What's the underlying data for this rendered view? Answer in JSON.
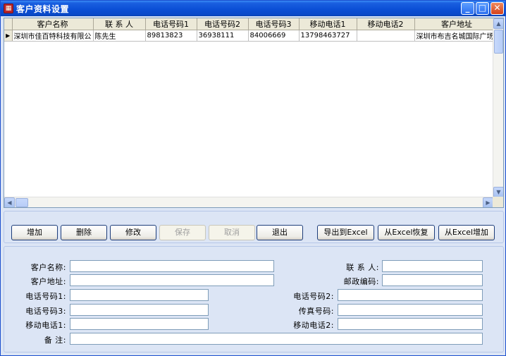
{
  "window": {
    "title": "客户资料设置"
  },
  "grid": {
    "columns": [
      "客户名称",
      "联 系 人",
      "电话号码1",
      "电话号码2",
      "电话号码3",
      "移动电话1",
      "移动电话2",
      "客户地址"
    ],
    "rows": [
      [
        "深圳市佳百特科技有限公",
        "陈先生",
        "89813823",
        "36938111",
        "84006669",
        "13798463727",
        "",
        "深圳市布吉名城国际广场"
      ]
    ],
    "current_row_marker": "▶"
  },
  "buttons": {
    "add": "增加",
    "delete": "删除",
    "modify": "修改",
    "save": "保存",
    "cancel": "取消",
    "exit": "退出",
    "export_excel": "导出到Excel",
    "restore_excel": "从Excel恢复",
    "add_excel": "从Excel增加"
  },
  "form": {
    "customer_name_label": "客户名称:",
    "contact_label": "联 系 人:",
    "address_label": "客户地址:",
    "postcode_label": "邮政编码:",
    "phone1_label": "电话号码1:",
    "phone2_label": "电话号码2:",
    "phone3_label": "电话号码3:",
    "fax_label": "传真号码:",
    "mobile1_label": "移动电话1:",
    "mobile2_label": "移动电话2:",
    "remark_label": "备  注:"
  },
  "icons": [
    "app-icon",
    "minimize-icon",
    "maximize-icon",
    "close-icon",
    "scroll-up-icon",
    "scroll-down-icon",
    "scroll-left-icon",
    "scroll-right-icon",
    "row-pointer-icon"
  ]
}
